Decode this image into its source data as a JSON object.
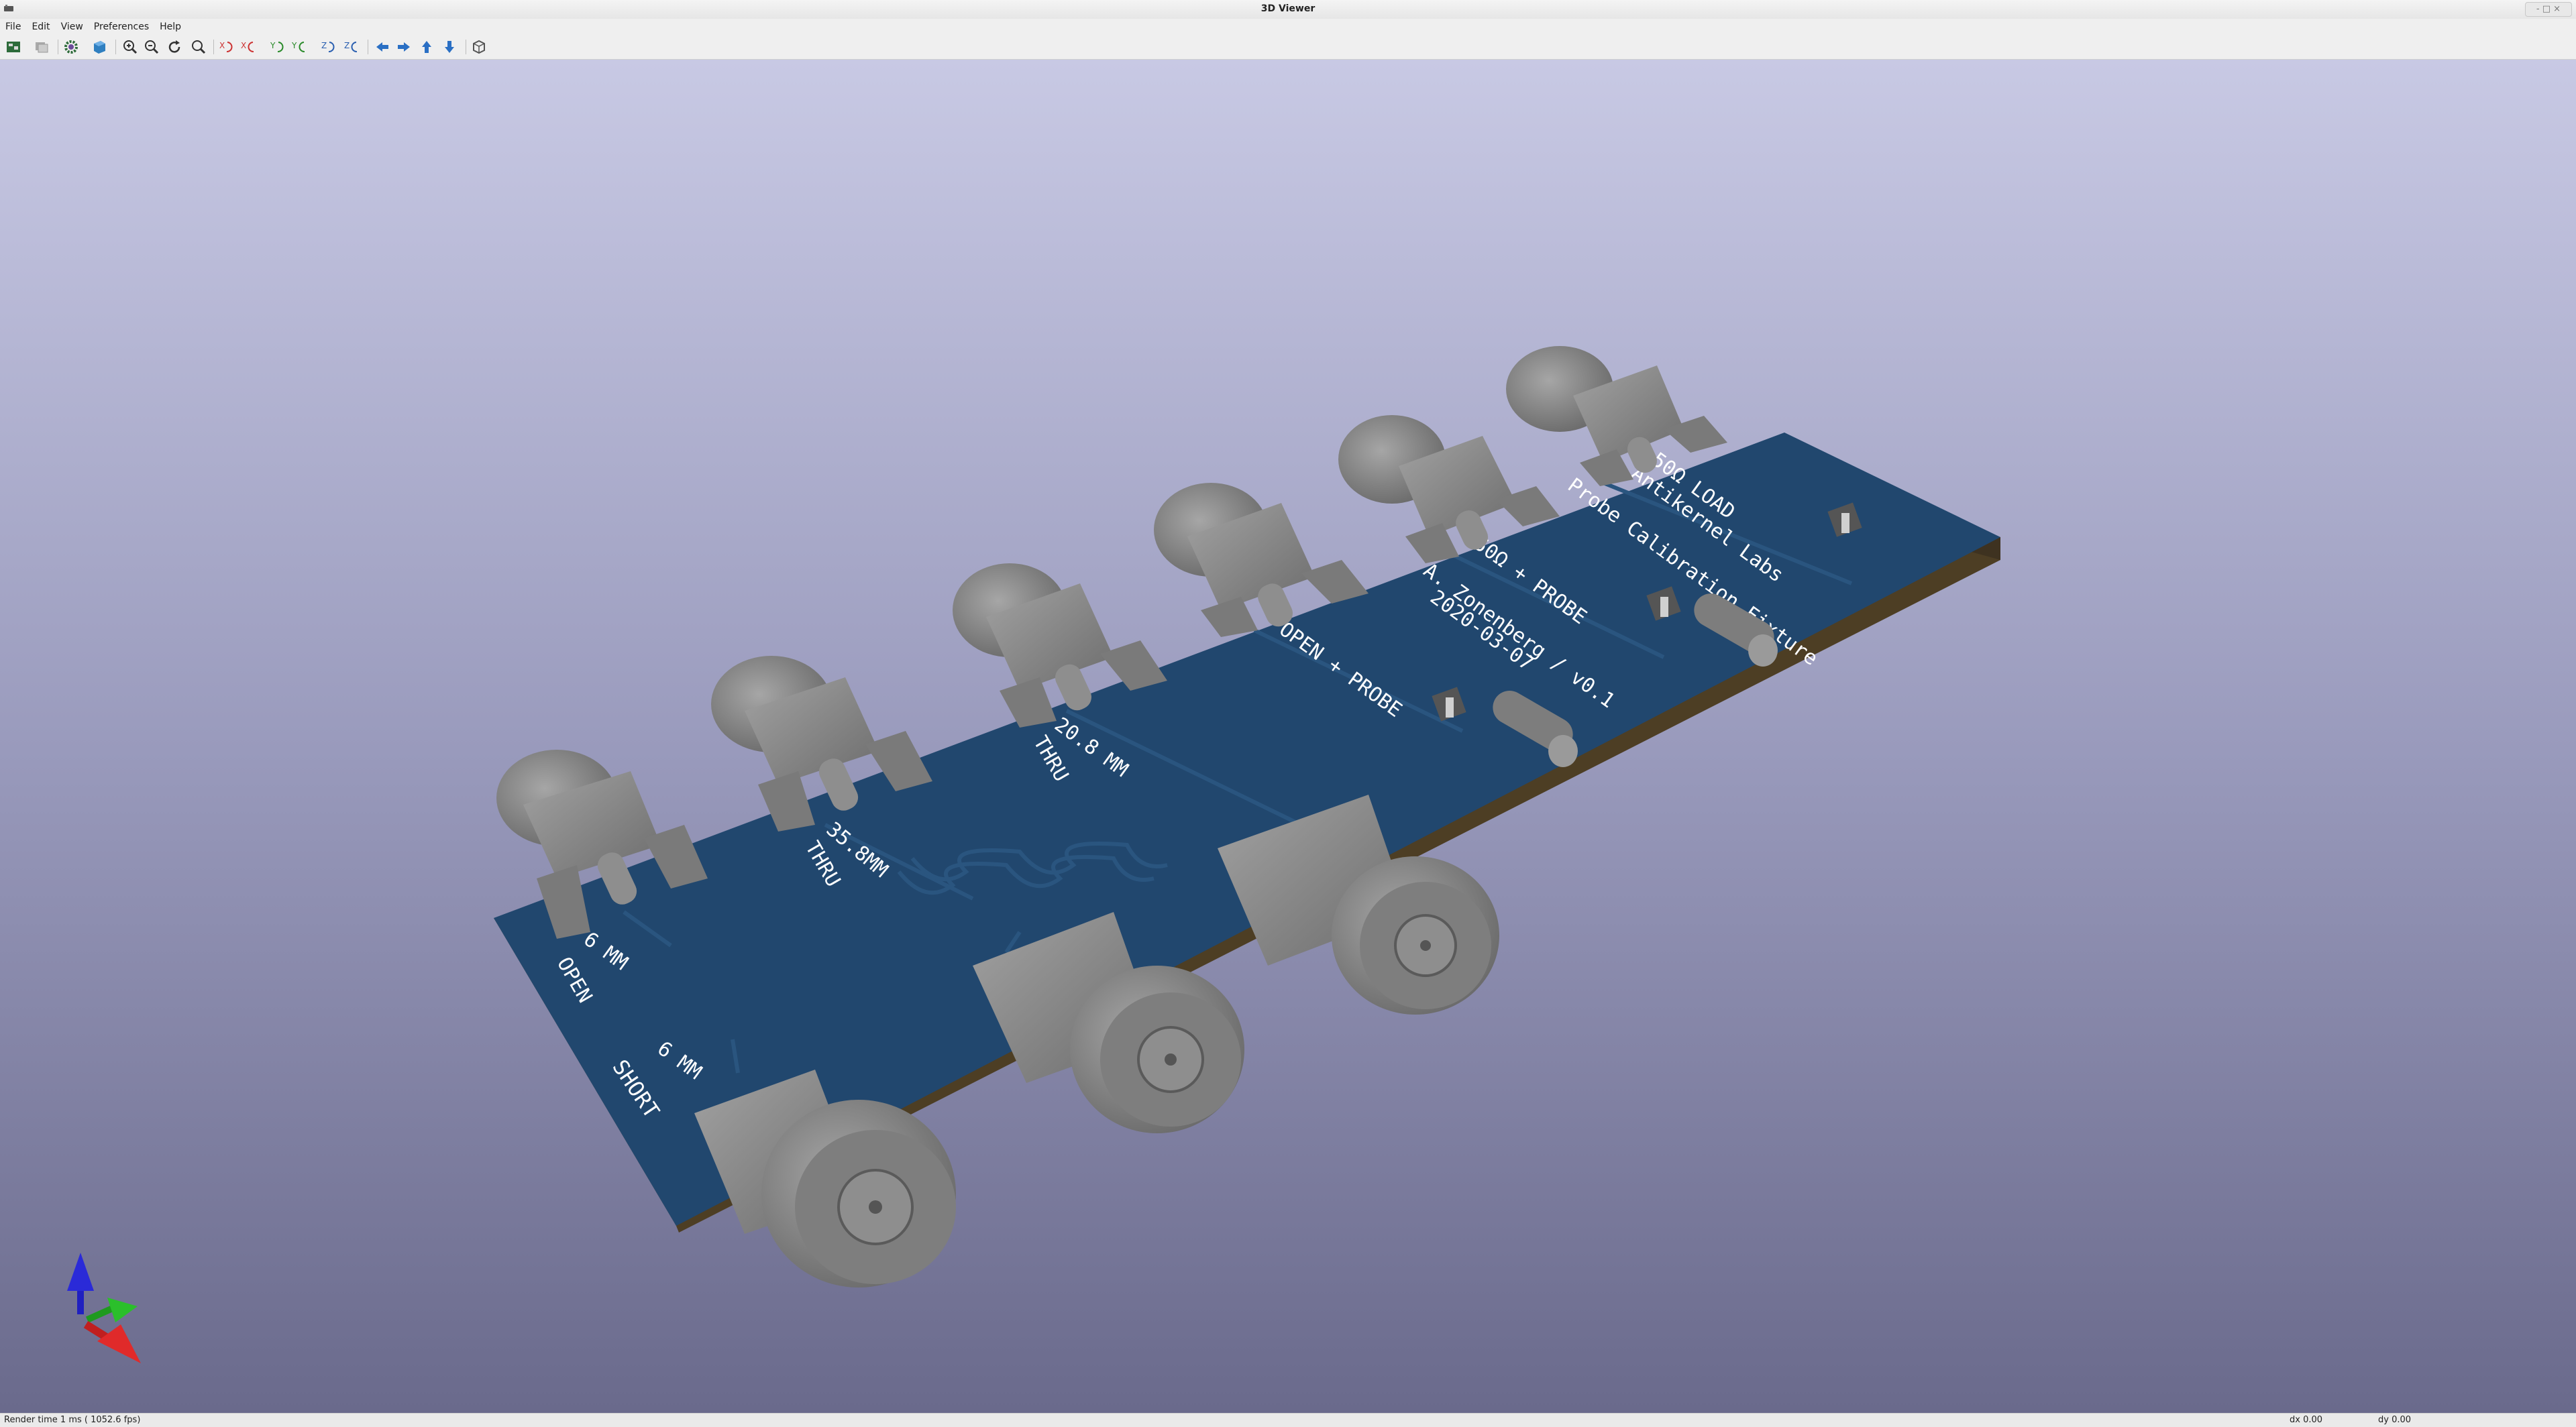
{
  "window": {
    "title": "3D Viewer",
    "controls_label": "- □ ×"
  },
  "menu": [
    "File",
    "Edit",
    "View",
    "Preferences",
    "Help"
  ],
  "toolbar": {
    "buttons": [
      "render-pcb-icon",
      "copy-image-icon",
      "settings-gear-icon",
      "raytrace-cube-icon",
      "zoom-in-icon",
      "zoom-out-icon",
      "redraw-icon",
      "zoom-fit-icon",
      "rotate-x-cw-icon",
      "rotate-x-ccw-icon",
      "rotate-y-cw-icon",
      "rotate-y-ccw-icon",
      "rotate-z-cw-icon",
      "rotate-z-ccw-icon",
      "pan-left-icon",
      "pan-right-icon",
      "pan-up-icon",
      "pan-down-icon",
      "ortho-view-icon"
    ]
  },
  "pcb": {
    "labels": {
      "open": [
        "6 MM",
        "OPEN"
      ],
      "short": [
        "6 MM",
        "SHORT"
      ],
      "thru35": [
        "35.8MM",
        "THRU"
      ],
      "thru20": [
        "20.8 MM",
        "THRU"
      ],
      "open_probe": "OPEN + PROBE",
      "load_probe": "50Ω + PROBE",
      "load": "50Ω LOAD",
      "author": [
        "A. Zonenberg / v0.1",
        "2020-03-07"
      ],
      "product": [
        "Antikernel Labs",
        "Probe Calibration Fixture"
      ]
    },
    "colors": {
      "board_top": "#21476e",
      "board_edge": "#4d3e24",
      "connector": "#8a8a8a",
      "background_top": "#c8c9e4",
      "background_bottom": "#6a6a8c"
    }
  },
  "axes": {
    "x": "red",
    "y": "green",
    "z": "blue"
  },
  "status": {
    "render_time": "Render time 1 ms ( 1052.6 fps)",
    "dx": "dx 0.00",
    "dy": "dy 0.00"
  }
}
